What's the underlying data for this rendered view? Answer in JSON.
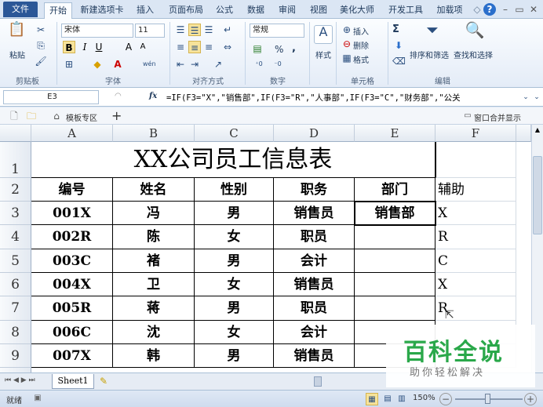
{
  "ribbon_tabs": [
    "文件",
    "开始",
    "新建选项卡",
    "插入",
    "页面布局",
    "公式",
    "数据",
    "审阅",
    "视图",
    "美化大师",
    "开发工具",
    "加载项"
  ],
  "home": {
    "clipboard": {
      "paste": "粘贴",
      "label": "剪贴板"
    },
    "font": {
      "name": "宋体",
      "size": "11",
      "bold": "B",
      "italic": "I",
      "underline": "U",
      "label": "字体",
      "grow": "A",
      "shrink": "A",
      "phonetic": "wén"
    },
    "alignment": {
      "label": "对齐方式"
    },
    "number": {
      "format": "常规",
      "percent": "%",
      "comma": ",",
      "label": "数字"
    },
    "styles": {
      "label": "样式"
    },
    "cells": {
      "insert": "插入",
      "delete": "删除",
      "format": "格式",
      "label": "单元格"
    },
    "editing": {
      "sigma": "Σ",
      "sort": "排序和筛选",
      "find": "查找和选择",
      "label": "编辑"
    }
  },
  "formula_bar": {
    "name_box": "E3",
    "fx": "fx",
    "formula": "=IF(F3=\"X\",\"销售部\",IF(F3=\"R\",\"人事部\",IF(F3=\"C\",\"财务部\",\"公关"
  },
  "doc_tabs": {
    "templates": "模板专区",
    "add": "+",
    "merge_windows": "窗口合并显示"
  },
  "columns": [
    "A",
    "B",
    "C",
    "D",
    "E",
    "F"
  ],
  "rows": [
    "1",
    "2",
    "3",
    "4",
    "5",
    "6",
    "7",
    "8",
    "9"
  ],
  "sheet": {
    "title": "XX公司员工信息表",
    "headers": [
      "编号",
      "姓名",
      "性别",
      "职务",
      "部门",
      "辅助"
    ],
    "data": [
      [
        "001X",
        "冯",
        "男",
        "销售员",
        "销售部",
        "X"
      ],
      [
        "002R",
        "陈",
        "女",
        "职员",
        "",
        "R"
      ],
      [
        "003C",
        "褚",
        "男",
        "会计",
        "",
        "C"
      ],
      [
        "004X",
        "卫",
        "女",
        "销售员",
        "",
        "X"
      ],
      [
        "005R",
        "蒋",
        "男",
        "职员",
        "",
        "R"
      ],
      [
        "006C",
        "沈",
        "女",
        "会计",
        "",
        ""
      ],
      [
        "007X",
        "韩",
        "男",
        "销售员",
        "",
        ""
      ]
    ]
  },
  "sheet_tabs": [
    "Sheet1"
  ],
  "status": {
    "mode": "就绪",
    "zoom": "150%"
  },
  "watermark": {
    "title": "百科全说",
    "subtitle": "助你轻松解决"
  }
}
